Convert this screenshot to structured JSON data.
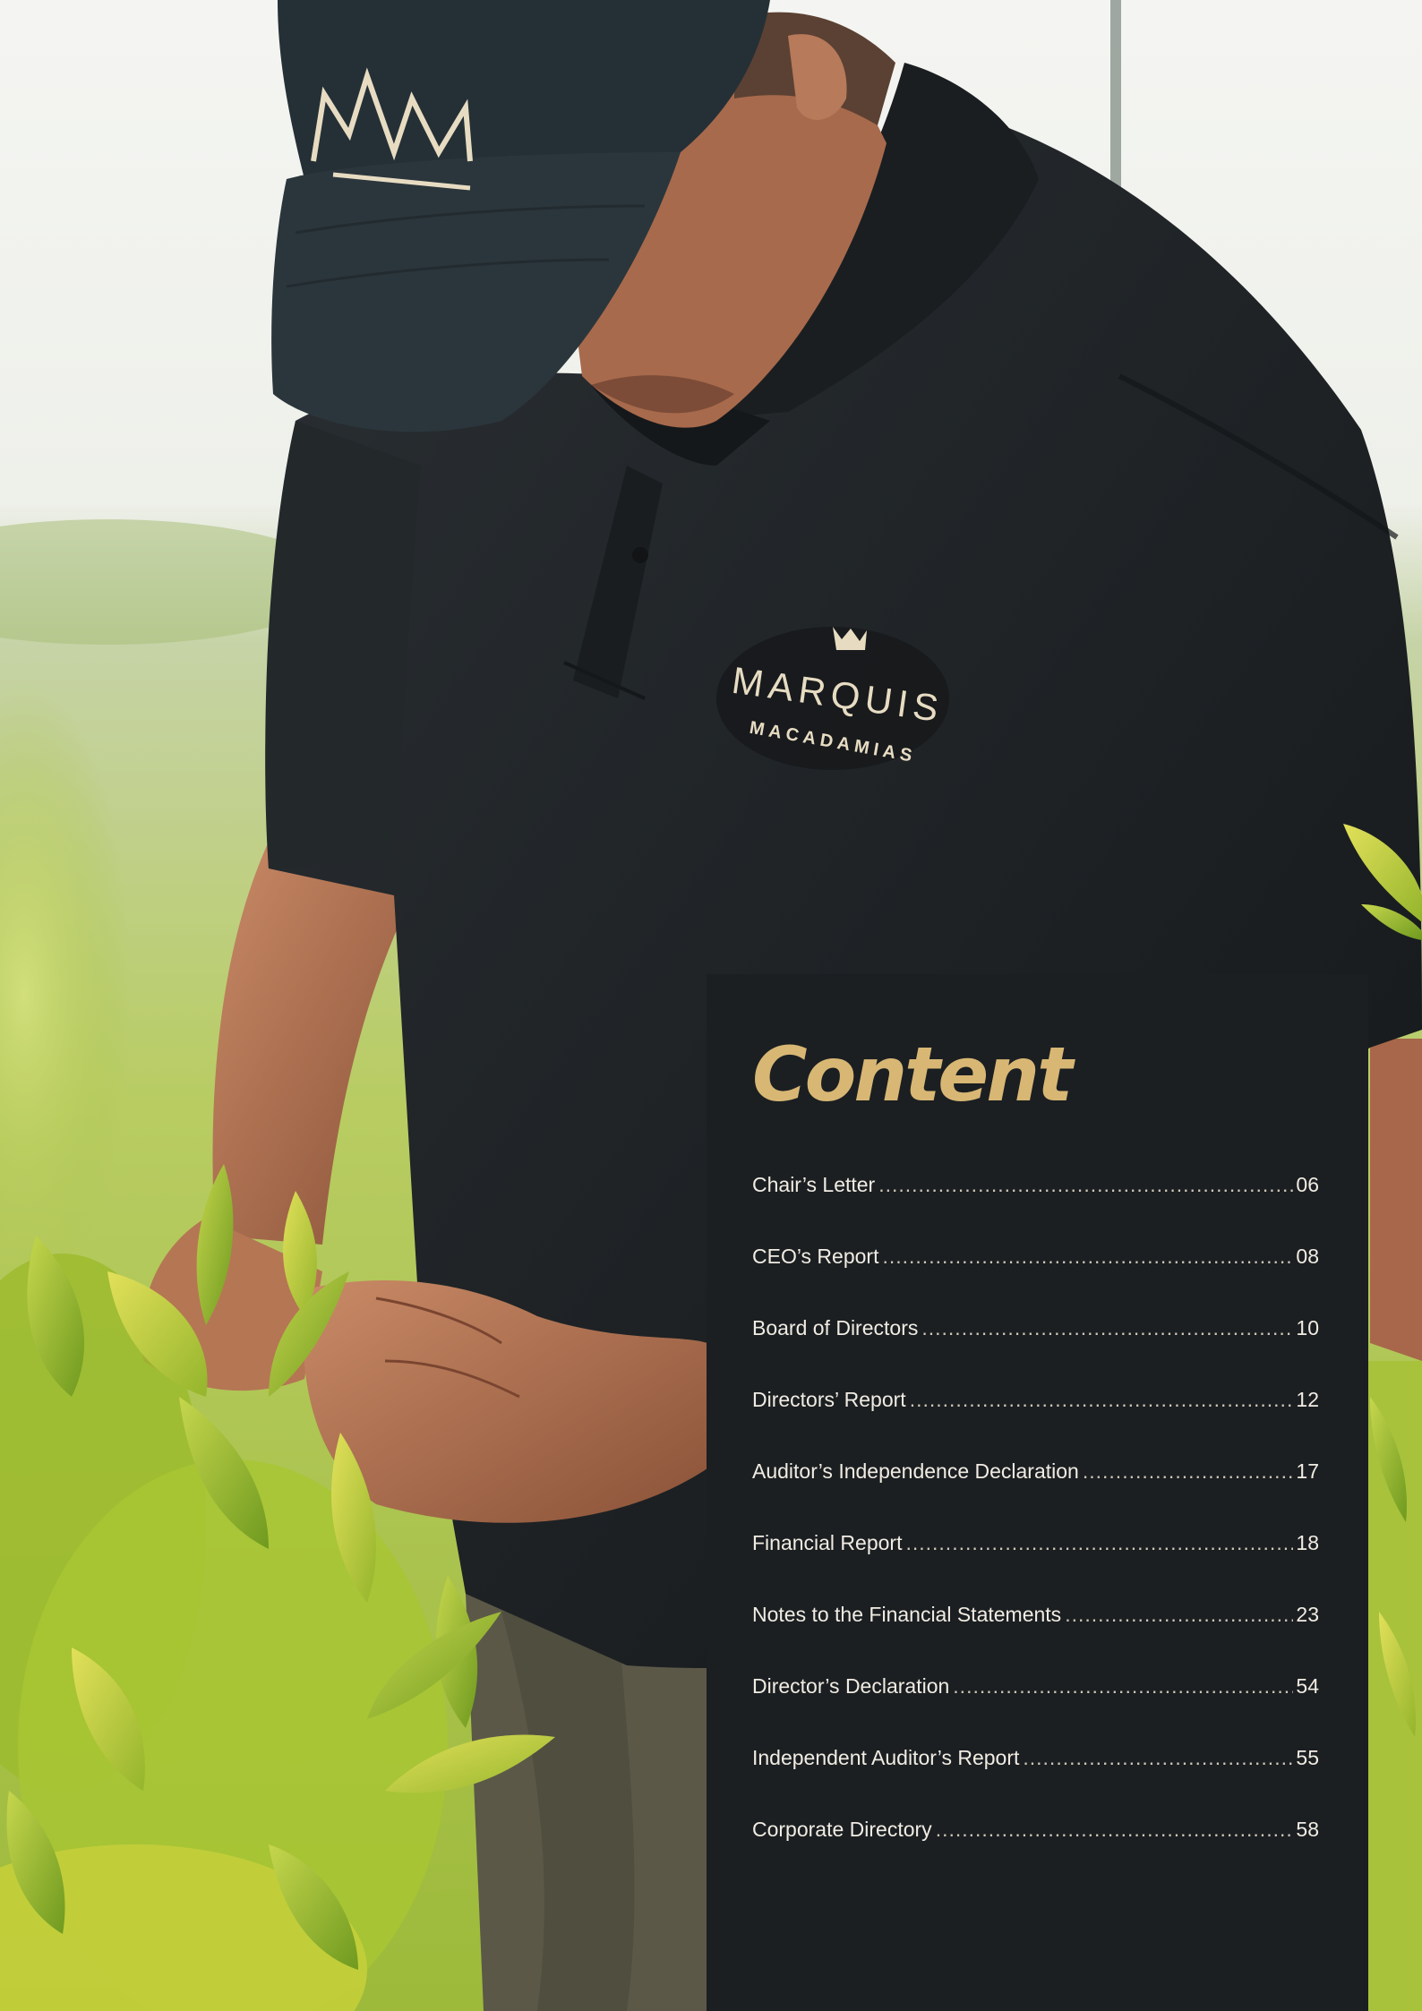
{
  "contents": {
    "title": "Content",
    "items": [
      {
        "label": "Chair’s Letter",
        "page": "06"
      },
      {
        "label": "CEO’s Report",
        "page": "08"
      },
      {
        "label": "Board of Directors",
        "page": "10"
      },
      {
        "label": "Directors’ Report",
        "page": "12"
      },
      {
        "label": "Auditor’s Independence Declaration",
        "page": "17"
      },
      {
        "label": "Financial Report",
        "page": "18"
      },
      {
        "label": "Notes to the Financial Statements",
        "page": "23"
      },
      {
        "label": "Director’s Declaration",
        "page": "54"
      },
      {
        "label": "Independent Auditor’s Report",
        "page": "55"
      },
      {
        "label": "Corporate Directory",
        "page": "58"
      }
    ]
  },
  "photo": {
    "cap_logo": "MM",
    "shirt_logo_line1": "MARQUIS",
    "shirt_logo_line2": "MACADAMIAS"
  },
  "colors": {
    "panel_background": "#1b1f22",
    "title_gold": "#d8b774",
    "text_light": "#f1ece3",
    "shirt_dark": "#1f2326",
    "foliage_green": "#a4c43c"
  }
}
